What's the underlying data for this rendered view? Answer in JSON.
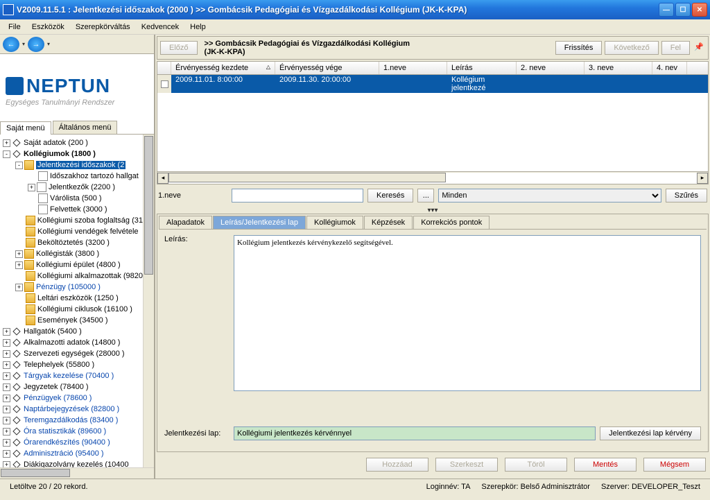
{
  "window": {
    "title": "V2009.11.5.1 : Jelentkezési időszakok (2000   )   >> Gombácsik Pedagógiai és Vízgazdálkodási Kollégium (JK-K-KPA)"
  },
  "menubar": {
    "items": [
      "File",
      "Eszközök",
      "Szerepkörváltás",
      "Kedvencek",
      "Help"
    ]
  },
  "logo": {
    "text": "NEPTUN",
    "subtitle": "Egységes Tanulmányi Rendszer"
  },
  "lefttabs": {
    "items": [
      "Saját menü",
      "Általános menü"
    ],
    "activeIndex": 0
  },
  "tree": [
    {
      "lvl": 0,
      "tog": "+",
      "icon": "diamond",
      "label": "Saját adatok (200  )"
    },
    {
      "lvl": 0,
      "tog": "-",
      "icon": "diamond",
      "label": "Kollégiumok (1800  )",
      "bold": true
    },
    {
      "lvl": 1,
      "tog": "-",
      "icon": "folder",
      "label": "Jelentkezési időszakok (2",
      "selected": true
    },
    {
      "lvl": 2,
      "tog": " ",
      "icon": "page",
      "label": "Időszakhoz tartozó hallgat"
    },
    {
      "lvl": 2,
      "tog": "+",
      "icon": "page",
      "label": "Jelentkezők (2200  )"
    },
    {
      "lvl": 2,
      "tog": " ",
      "icon": "page",
      "label": "Várólista (500  )"
    },
    {
      "lvl": 2,
      "tog": " ",
      "icon": "page",
      "label": "Felvettek (3000  )"
    },
    {
      "lvl": 1,
      "tog": " ",
      "icon": "folder",
      "label": "Kollégiumi szoba foglaltság (31"
    },
    {
      "lvl": 1,
      "tog": " ",
      "icon": "folder",
      "label": "Kollégiumi vendégek felvétele"
    },
    {
      "lvl": 1,
      "tog": " ",
      "icon": "folder",
      "label": "Beköltöztetés (3200  )"
    },
    {
      "lvl": 1,
      "tog": "+",
      "icon": "folder",
      "label": "Kollégisták (3800  )"
    },
    {
      "lvl": 1,
      "tog": "+",
      "icon": "folder",
      "label": "Kollégiumi épület (4800  )"
    },
    {
      "lvl": 1,
      "tog": " ",
      "icon": "folder",
      "label": "Kollégiumi alkalmazottak (9820"
    },
    {
      "lvl": 1,
      "tog": "+",
      "icon": "folder",
      "label": "Pénzügy (105000  )",
      "blue": true
    },
    {
      "lvl": 1,
      "tog": " ",
      "icon": "folder",
      "label": "Leltári eszközök (1250  )"
    },
    {
      "lvl": 1,
      "tog": " ",
      "icon": "folder",
      "label": "Kollégiumi ciklusok (16100  )"
    },
    {
      "lvl": 1,
      "tog": " ",
      "icon": "folder",
      "label": "Események (34500  )"
    },
    {
      "lvl": 0,
      "tog": "+",
      "icon": "diamond",
      "label": "Hallgatók (5400  )"
    },
    {
      "lvl": 0,
      "tog": "+",
      "icon": "diamond",
      "label": "Alkalmazotti adatok (14800  )"
    },
    {
      "lvl": 0,
      "tog": "+",
      "icon": "diamond",
      "label": "Szervezeti egységek (28000  )"
    },
    {
      "lvl": 0,
      "tog": "+",
      "icon": "diamond",
      "label": "Telephelyek (55800  )"
    },
    {
      "lvl": 0,
      "tog": "+",
      "icon": "diamond",
      "label": "Tárgyak kezelése (70400  )",
      "blue": true
    },
    {
      "lvl": 0,
      "tog": "+",
      "icon": "diamond",
      "label": "Jegyzetek (78400  )"
    },
    {
      "lvl": 0,
      "tog": "+",
      "icon": "diamond",
      "label": "Pénzügyek (78600  )",
      "blue": true
    },
    {
      "lvl": 0,
      "tog": "+",
      "icon": "diamond",
      "label": "Naptárbejegyzések (82800  )",
      "blue": true
    },
    {
      "lvl": 0,
      "tog": "+",
      "icon": "diamond",
      "label": "Teremgazdálkodás (83400  )",
      "blue": true
    },
    {
      "lvl": 0,
      "tog": "+",
      "icon": "diamond",
      "label": "Óra statisztikák (89600  )",
      "blue": true
    },
    {
      "lvl": 0,
      "tog": "+",
      "icon": "diamond",
      "label": "Órarendkészítés (90400  )",
      "blue": true
    },
    {
      "lvl": 0,
      "tog": "+",
      "icon": "diamond",
      "label": "Adminisztráció (95400  )",
      "blue": true
    },
    {
      "lvl": 0,
      "tog": "+",
      "icon": "diamond",
      "label": "Diákigazolvány kezelés (10400"
    }
  ],
  "toprow": {
    "prev": "Előző",
    "crumb1": ">> Gombácsik Pedagógiai és Vízgazdálkodási Kollégium",
    "crumb2": "(JK-K-KPA)",
    "refresh": "Frissítés",
    "next": "Következő",
    "up": "Fel"
  },
  "grid": {
    "headers": [
      "",
      "Érvényesség kezdete",
      "Érvényesség vége",
      "1.neve",
      "Leírás",
      "2. neve",
      "3. neve",
      "4. nev"
    ],
    "widths": [
      20,
      150,
      150,
      98,
      100,
      98,
      98,
      50
    ],
    "rows": [
      {
        "cells": [
          "",
          "2009.11.01. 8:00:00",
          "2009.11.30. 20:00:00",
          "",
          "Kollégium jelentkezé",
          "",
          "",
          ""
        ]
      }
    ]
  },
  "filter": {
    "label": "1.neve",
    "search": "Keresés",
    "dots": "...",
    "select": "Minden",
    "szures": "Szűrés"
  },
  "dtabs": {
    "items": [
      "Alapadatok",
      "Leírás/Jelentkezési lap",
      "Kollégiumok",
      "Képzések",
      "Korrekciós pontok"
    ],
    "activeIndex": 1
  },
  "detail": {
    "leiras_label": "Leírás:",
    "leiras_text": "Kollégium jelentkezés kérvénykezelő segítségével.",
    "lap_label": "Jelentkezési lap:",
    "lap_value": "Kollégiumi jelentkezés kérvénnyel",
    "lap_btn": "Jelentkezési lap kérvény"
  },
  "bottom": {
    "add": "Hozzáad",
    "edit": "Szerkeszt",
    "del": "Töröl",
    "save": "Mentés",
    "cancel": "Mégsem"
  },
  "status": {
    "records": "Letöltve 20 / 20 rekord.",
    "login": "Loginnév: TA",
    "role": "Szerepkör: Belső Adminisztrátor",
    "server": "Szerver: DEVELOPER_Teszt"
  }
}
